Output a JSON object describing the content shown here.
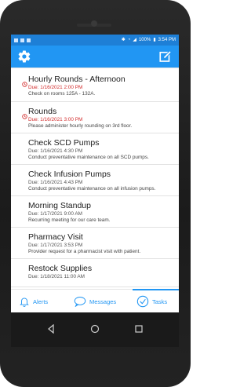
{
  "statusbar": {
    "time": "3:54 PM",
    "battery": "100%",
    "left_icons": [
      "sd-icon",
      "image-icon",
      "message-icon"
    ],
    "right_icons": [
      "bluetooth-icon",
      "wifi-icon",
      "signal-icon",
      "battery-icon"
    ]
  },
  "appbar": {
    "left_icon": "gear-icon",
    "right_icon": "edit-icon",
    "color": "#2196f3"
  },
  "tasks": [
    {
      "title": "Hourly Rounds - Afternoon",
      "due": "Due: 1/16/2021 2:00 PM",
      "desc": "Check on rooms 125A - 132A.",
      "overdue": true
    },
    {
      "title": "Rounds",
      "due": "Due: 1/16/2021 3:00 PM",
      "desc": "Please administer hourly rounding on 3rd floor.",
      "overdue": true
    },
    {
      "title": "Check SCD Pumps",
      "due": "Due: 1/16/2021 4:30 PM",
      "desc": "Conduct preventative maintenance on all SCD pumps.",
      "overdue": false
    },
    {
      "title": "Check Infusion Pumps",
      "due": "Due: 1/16/2021 4:43 PM",
      "desc": "Conduct preventative maintenance on all infusion pumps.",
      "overdue": false
    },
    {
      "title": "Morning Standup",
      "due": "Due: 1/17/2021 9:00 AM",
      "desc": "Recurring meeting for our care team.",
      "overdue": false
    },
    {
      "title": "Pharmacy Visit",
      "due": "Due: 1/17/2021 3:53 PM",
      "desc": "Provider request for a pharmacist visit with patient.",
      "overdue": false
    },
    {
      "title": "Restock Supplies",
      "due": "Due: 1/18/2021 11:00 AM",
      "desc": "",
      "overdue": false
    }
  ],
  "bottomnav": {
    "alerts": "Alerts",
    "messages": "Messages",
    "tasks": "Tasks",
    "active": "Tasks"
  },
  "colors": {
    "accent": "#2196f3",
    "overdue": "#d32f2f"
  }
}
